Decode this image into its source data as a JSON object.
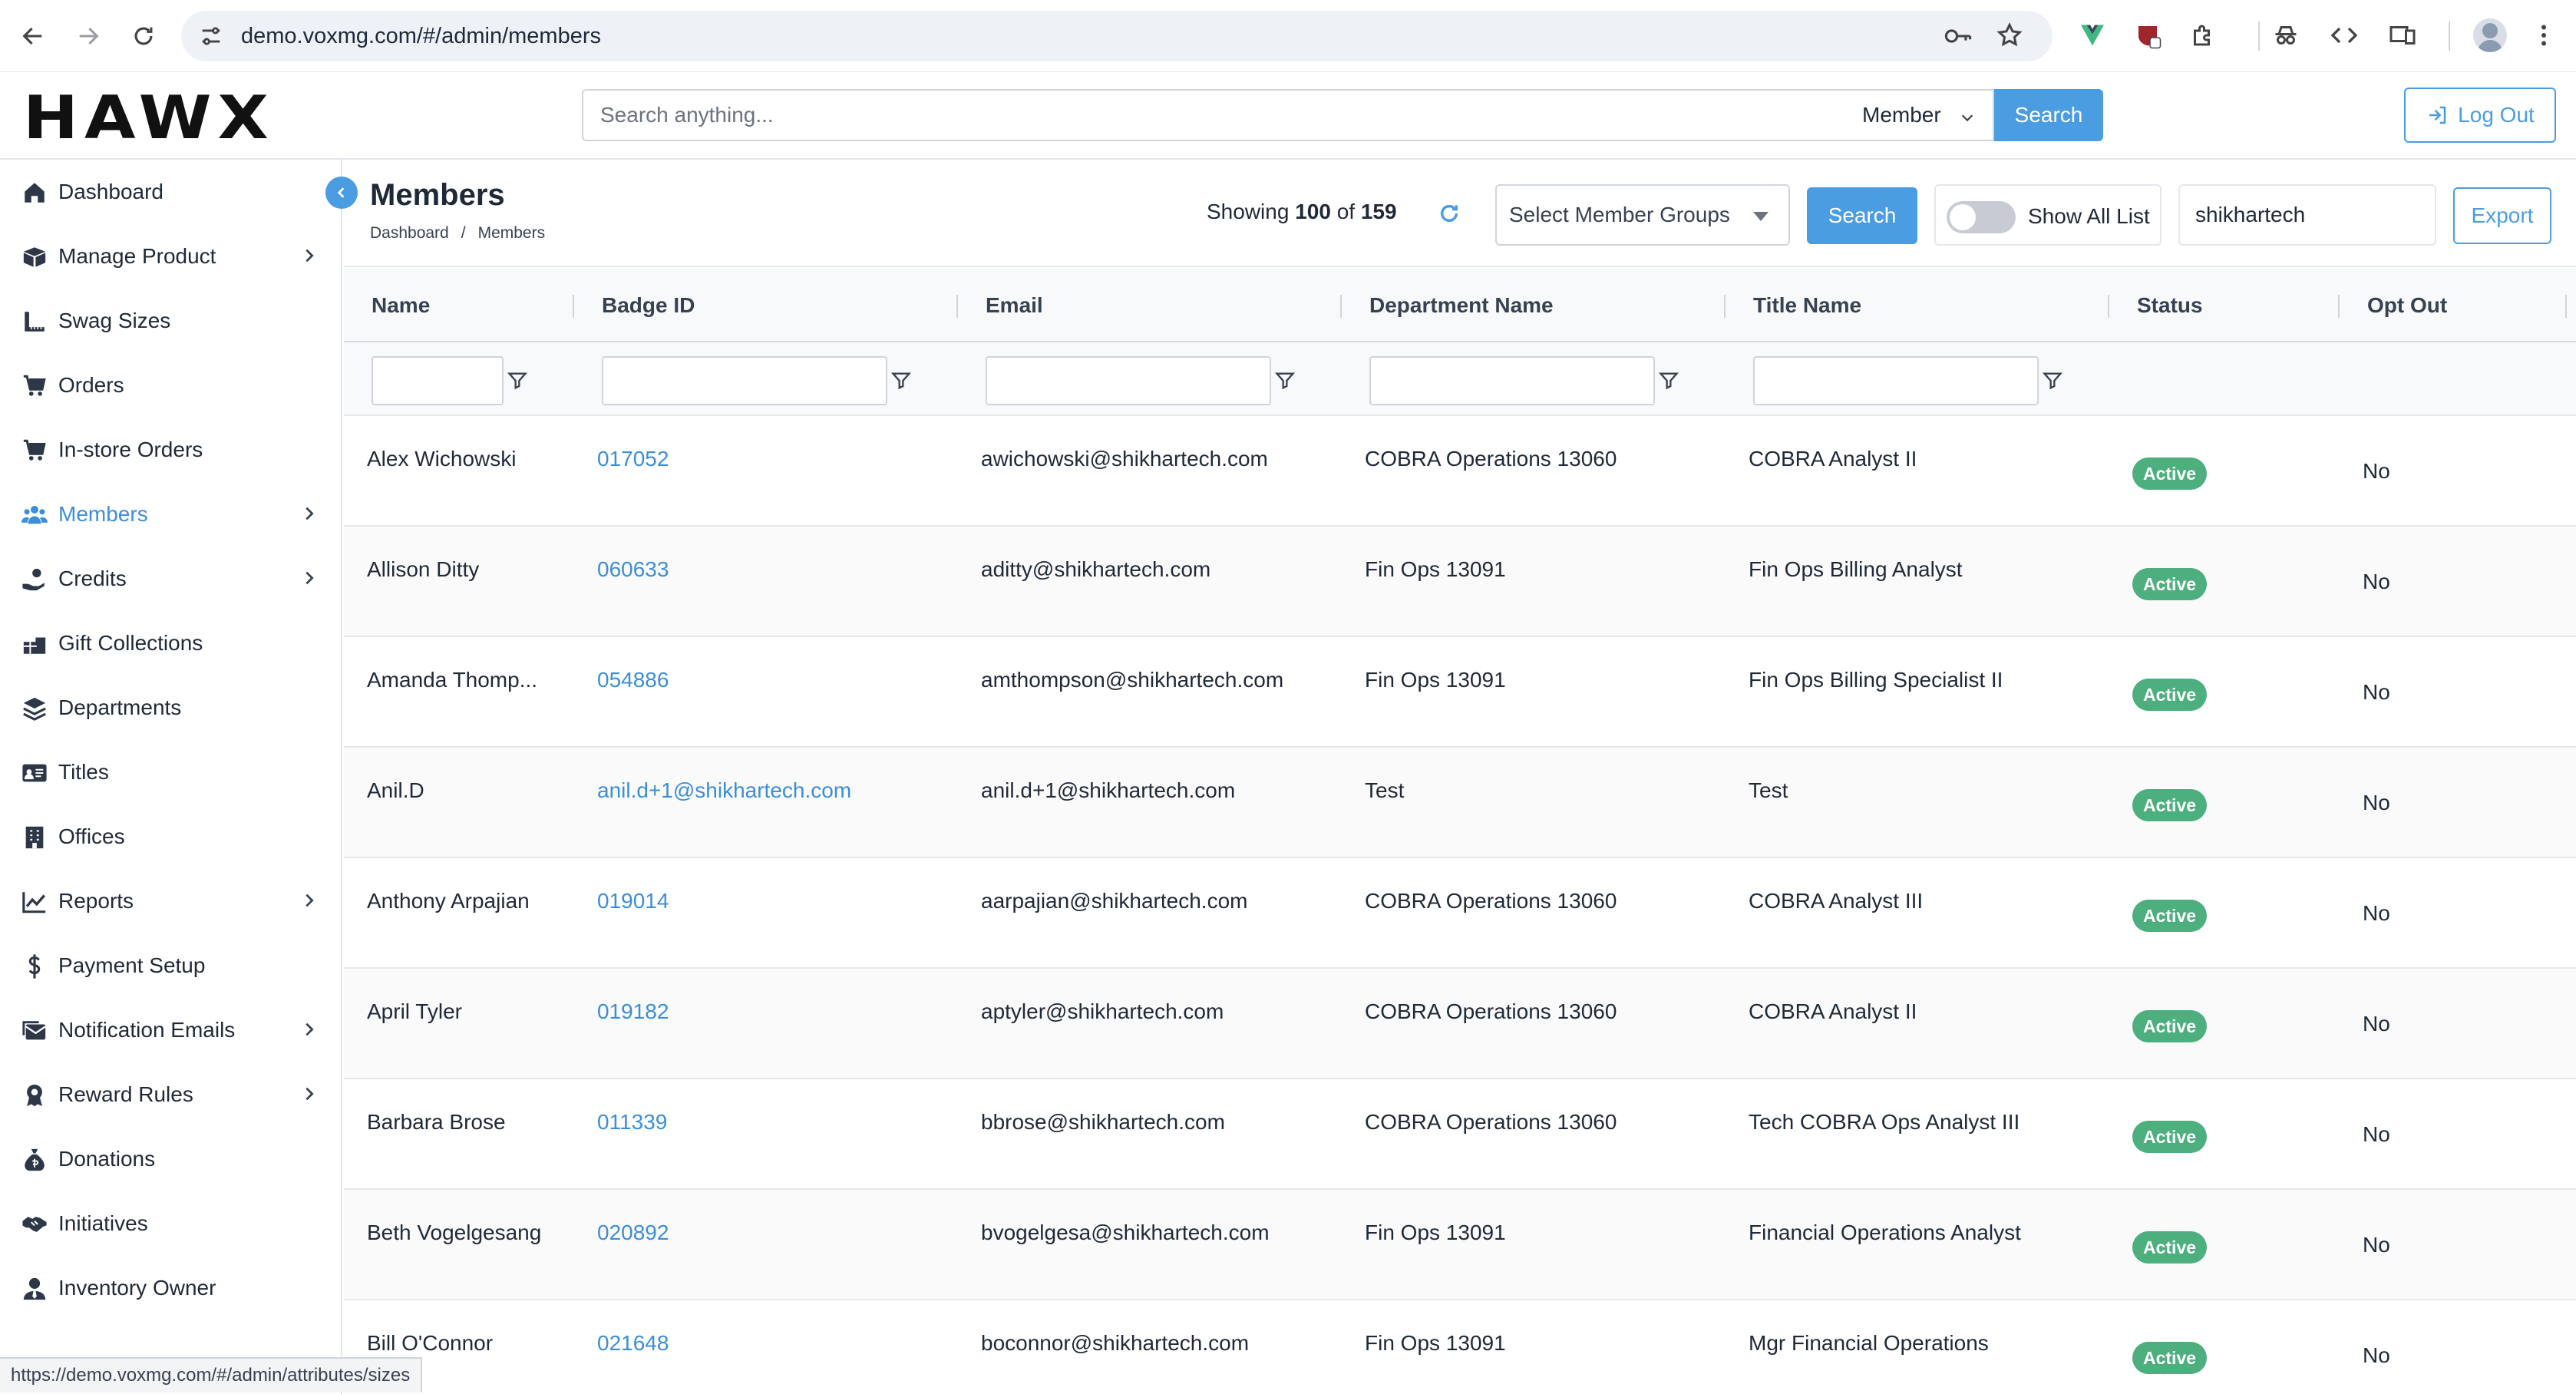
{
  "browser": {
    "url": "demo.voxmg.com/#/admin/members",
    "status_url": "https://demo.voxmg.com/#/admin/attributes/sizes"
  },
  "header": {
    "logo": "HAWX",
    "search_placeholder": "Search anything...",
    "search_type": "Member",
    "search_button": "Search",
    "logout": "Log Out"
  },
  "sidebar": {
    "items": [
      {
        "label": "Dashboard",
        "icon": "home-icon",
        "chevron": false
      },
      {
        "label": "Manage Product",
        "icon": "box-icon",
        "chevron": true
      },
      {
        "label": "Swag Sizes",
        "icon": "ruler-icon",
        "chevron": false
      },
      {
        "label": "Orders",
        "icon": "cart-icon",
        "chevron": false
      },
      {
        "label": "In-store Orders",
        "icon": "cart-icon",
        "chevron": false
      },
      {
        "label": "Members",
        "icon": "users-icon",
        "chevron": true,
        "active": true
      },
      {
        "label": "Credits",
        "icon": "hand-coin-icon",
        "chevron": true
      },
      {
        "label": "Gift Collections",
        "icon": "gifts-icon",
        "chevron": false
      },
      {
        "label": "Departments",
        "icon": "layers-icon",
        "chevron": false
      },
      {
        "label": "Titles",
        "icon": "id-card-icon",
        "chevron": false
      },
      {
        "label": "Offices",
        "icon": "building-icon",
        "chevron": false
      },
      {
        "label": "Reports",
        "icon": "chart-line-icon",
        "chevron": true
      },
      {
        "label": "Payment Setup",
        "icon": "dollar-icon",
        "chevron": false
      },
      {
        "label": "Notification Emails",
        "icon": "mail-bulk-icon",
        "chevron": true
      },
      {
        "label": "Reward Rules",
        "icon": "award-icon",
        "chevron": true
      },
      {
        "label": "Donations",
        "icon": "money-bag-icon",
        "chevron": false
      },
      {
        "label": "Initiatives",
        "icon": "handshake-icon",
        "chevron": false
      },
      {
        "label": "Inventory Owner",
        "icon": "user-tie-icon",
        "chevron": false
      }
    ]
  },
  "page": {
    "title": "Members",
    "breadcrumb": [
      "Dashboard",
      "/",
      "Members"
    ],
    "showing_prefix": "Showing",
    "showing_count": "100",
    "showing_of": "of",
    "showing_total": "159",
    "group_select_placeholder": "Select Member Groups",
    "search_button": "Search",
    "show_all_label": "Show All List",
    "company_filter": "shikhartech",
    "export_button": "Export"
  },
  "table": {
    "columns": [
      "Name",
      "Badge ID",
      "Email",
      "Department Name",
      "Title Name",
      "Status",
      "Opt Out"
    ],
    "rows": [
      {
        "name": "Alex Wichowski",
        "badge": "017052",
        "email": "awichowski@shikhartech.com",
        "department": "COBRA Operations 13060",
        "title": "COBRA Analyst II",
        "status": "Active",
        "opt_out": "No"
      },
      {
        "name": "Allison Ditty",
        "badge": "060633",
        "email": "aditty@shikhartech.com",
        "department": "Fin Ops 13091",
        "title": "Fin Ops Billing Analyst",
        "status": "Active",
        "opt_out": "No"
      },
      {
        "name": "Amanda Thomp...",
        "badge": "054886",
        "email": "amthompson@shikhartech.com",
        "department": "Fin Ops 13091",
        "title": "Fin Ops Billing Specialist II",
        "status": "Active",
        "opt_out": "No"
      },
      {
        "name": "Anil.D",
        "badge": "anil.d+1@shikhartech.com",
        "email": "anil.d+1@shikhartech.com",
        "department": "Test",
        "title": "Test",
        "status": "Active",
        "opt_out": "No"
      },
      {
        "name": "Anthony Arpajian",
        "badge": "019014",
        "email": "aarpajian@shikhartech.com",
        "department": "COBRA Operations 13060",
        "title": "COBRA Analyst III",
        "status": "Active",
        "opt_out": "No"
      },
      {
        "name": "April Tyler",
        "badge": "019182",
        "email": "aptyler@shikhartech.com",
        "department": "COBRA Operations 13060",
        "title": "COBRA Analyst II",
        "status": "Active",
        "opt_out": "No"
      },
      {
        "name": "Barbara Brose",
        "badge": "011339",
        "email": "bbrose@shikhartech.com",
        "department": "COBRA Operations 13060",
        "title": "Tech COBRA Ops Analyst III",
        "status": "Active",
        "opt_out": "No"
      },
      {
        "name": "Beth Vogelgesang",
        "badge": "020892",
        "email": "bvogelgesa@shikhartech.com",
        "department": "Fin Ops 13091",
        "title": "Financial Operations Analyst",
        "status": "Active",
        "opt_out": "No"
      },
      {
        "name": "Bill O'Connor",
        "badge": "021648",
        "email": "boconnor@shikhartech.com",
        "department": "Fin Ops 13091",
        "title": "Mgr Financial Operations",
        "status": "Active",
        "opt_out": "No"
      }
    ]
  },
  "colors": {
    "accent": "#4a9de0",
    "link": "#3b8ed8",
    "active_badge": "#4caf7d"
  }
}
